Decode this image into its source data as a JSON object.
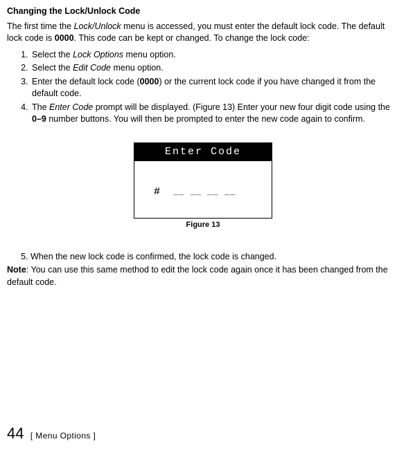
{
  "heading": "Changing the Lock/Unlock Code",
  "intro_p1": "The first time the ",
  "intro_menu": "Lock/Unlock",
  "intro_p2": " menu is accessed, you must enter the default lock code. The default lock code is ",
  "intro_code": "0000",
  "intro_p3": ". This code can be kept or changed. To change the lock code:",
  "steps": {
    "s1_a": "Select the ",
    "s1_em": "Lock Options",
    "s1_b": " menu option.",
    "s2_a": "Select the ",
    "s2_em": "Edit Code",
    "s2_b": " menu option.",
    "s3_a": "Enter the default lock code (",
    "s3_bold": "0000",
    "s3_b": ") or the current lock code if you have changed it from the default code.",
    "s4_a": "The ",
    "s4_em": "Enter Code",
    "s4_b": " prompt will be displayed. (Figure 13) Enter your new four digit code using the ",
    "s4_bold": "0–9",
    "s4_c": " number buttons. You will then be prompted to enter the new code again to confirm."
  },
  "figure": {
    "title": "Enter Code",
    "entry_symbol": "#",
    "entry_blanks": " __  __  __  __",
    "caption": "Figure 13"
  },
  "step5": "When the new lock code is confirmed, the lock code is changed.",
  "note_label": "Note",
  "note_text": ": You can use this same method to edit the lock code again once it has been changed from the default code.",
  "footer": {
    "page": "44",
    "crumb": "[ Menu Options ]"
  }
}
